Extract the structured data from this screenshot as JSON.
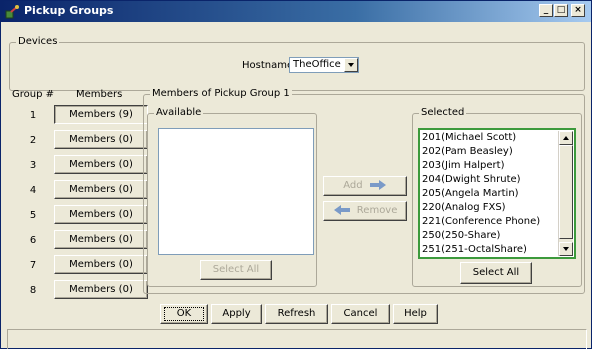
{
  "window": {
    "title": "Pickup Groups",
    "minimize_glyph": "_",
    "maximize_glyph": "□",
    "close_glyph": "×",
    "icon": "phone-pickup-icon"
  },
  "devices": {
    "legend": "Devices",
    "hostname_label": "Hostname:",
    "hostname_value": "TheOffice"
  },
  "groups": {
    "header_group": "Group #",
    "header_members": "Members",
    "rows": [
      {
        "num": "1",
        "label": "Members (9)",
        "active": true
      },
      {
        "num": "2",
        "label": "Members (0)"
      },
      {
        "num": "3",
        "label": "Members (0)"
      },
      {
        "num": "4",
        "label": "Members (0)"
      },
      {
        "num": "5",
        "label": "Members (0)"
      },
      {
        "num": "6",
        "label": "Members (0)"
      },
      {
        "num": "7",
        "label": "Members (0)"
      },
      {
        "num": "8",
        "label": "Members (0)"
      }
    ]
  },
  "pickup": {
    "legend": "Members of Pickup Group 1",
    "available_legend": "Available",
    "selected_legend": "Selected",
    "add_label": "Add",
    "remove_label": "Remove",
    "select_all_left": "Select All",
    "select_all_right": "Select All",
    "selected_items": [
      "201(Michael Scott)",
      "202(Pam Beasley)",
      "203(Jim Halpert)",
      "204(Dwight Shrute)",
      "205(Angela Martin)",
      "220(Analog FXS)",
      "221(Conference Phone)",
      "250(250-Share)",
      "251(251-OctalShare)"
    ]
  },
  "buttons": {
    "ok": "OK",
    "apply": "Apply",
    "refresh": "Refresh",
    "cancel": "Cancel",
    "help": "Help"
  },
  "colors": {
    "titlebar": "#0a246a",
    "selected_list_border": "#3c9a3c",
    "face": "#ece9d8"
  }
}
